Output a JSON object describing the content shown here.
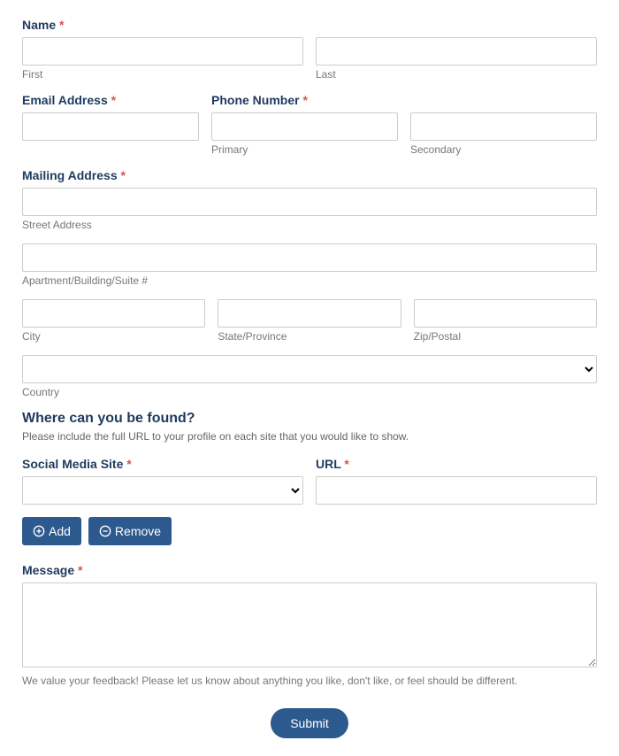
{
  "name": {
    "label": "Name",
    "required": "*",
    "first_helper": "First",
    "last_helper": "Last",
    "first_value": "",
    "last_value": ""
  },
  "email": {
    "label": "Email Address",
    "required": "*",
    "value": ""
  },
  "phone": {
    "label": "Phone Number",
    "required": "*",
    "primary_helper": "Primary",
    "secondary_helper": "Secondary",
    "primary_value": "",
    "secondary_value": ""
  },
  "mailing": {
    "label": "Mailing Address",
    "required": "*",
    "street_helper": "Street Address",
    "apt_helper": "Apartment/Building/Suite #",
    "city_helper": "City",
    "state_helper": "State/Province",
    "zip_helper": "Zip/Postal",
    "country_helper": "Country",
    "street_value": "",
    "apt_value": "",
    "city_value": "",
    "state_value": "",
    "zip_value": "",
    "country_value": ""
  },
  "social_section": {
    "heading": "Where can you be found?",
    "description": "Please include the full URL to your profile on each site that you would like to show."
  },
  "social": {
    "site_label": "Social Media Site",
    "site_required": "*",
    "url_label": "URL",
    "url_required": "*",
    "site_value": "",
    "url_value": ""
  },
  "buttons": {
    "add": "Add",
    "remove": "Remove"
  },
  "message": {
    "label": "Message",
    "required": "*",
    "value": "",
    "helper": "We value your feedback! Please let us know about anything you like, don't like, or feel should be different."
  },
  "submit": "Submit"
}
